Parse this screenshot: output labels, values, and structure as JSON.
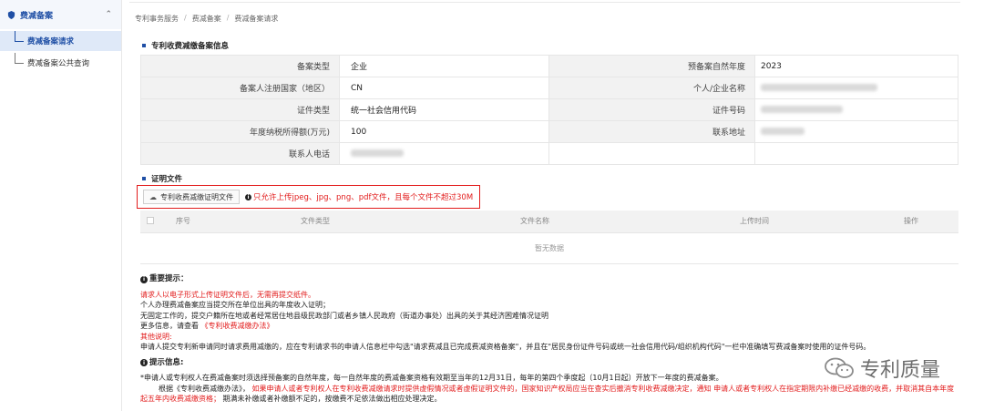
{
  "sidebar": {
    "group_label": "费减备案",
    "items": [
      {
        "label": "费减备案请求",
        "active": true
      },
      {
        "label": "费减备案公共查询",
        "active": false
      }
    ]
  },
  "breadcrumb": [
    "专利事务服务",
    "费减备案",
    "费减备案请求"
  ],
  "info": {
    "section_title": "专利收费减缴备案信息",
    "rows": [
      {
        "l1": "备案类型",
        "v1": "企业",
        "l2": "预备案自然年度",
        "v2": "2023"
      },
      {
        "l1": "备案人注册国家（地区）",
        "v1": "CN",
        "l2": "个人/企业名称",
        "v2": ""
      },
      {
        "l1": "证件类型",
        "v1": "统一社会信用代码",
        "l2": "证件号码",
        "v2": ""
      },
      {
        "l1": "年度纳税所得额(万元)",
        "v1": "100",
        "l2": "联系地址",
        "v2": ""
      },
      {
        "l1": "联系人电话",
        "v1": "",
        "l2": "",
        "v2": ""
      }
    ]
  },
  "files": {
    "section_title": "证明文件",
    "upload_button": "专利收费减缴证明文件",
    "upload_tip": "只允许上传jpeg、jpg、png、pdf文件，且每个文件不超过30M",
    "columns": [
      "序号",
      "文件类型",
      "文件名称",
      "上传时间",
      "操作"
    ],
    "empty_text": "暂无数据"
  },
  "notes": {
    "important_title": "重要提示：",
    "red_line": "请求人以电子形式上传证明文件后，无需再提交纸件。",
    "line1": "个人办理费减备案应当提交所在单位出具的年度收入证明；",
    "line2": "无固定工作的，提交户籍所在地或者经常居住地县级民政部门或者乡镇人民政府（街道办事处）出具的关于其经济困难情况证明",
    "line3_prefix": "更多信息，请查看",
    "line3_link": "《专利收费减缴办法》",
    "other_label": "其他说明:",
    "line4": "申请人提交专利新申请同时请求费用减缴的，应在专利请求书的申请人信息栏中勾选\"请求费减且已完成费减资格备案\"，并且在\"居民身份证件号码或统一社会信用代码/组织机构代码\"一栏中准确填写费减备案时使用的证件号码。",
    "tips_title": "提示信息:",
    "tip1": "*申请人或专利权人在费减备案时须选择预备案的自然年度，每一自然年度的费减备案资格有效期至当年的12月31日，每年的第四个季度起（10月1日起）开放下一年度的费减备案。",
    "tip2_prefix": "根据《专利收费减缴办法》，",
    "tip2_red": "如果申请人或者专利权人在专利收费减缴请求时提供虚假情况或者虚假证明文件的，国家知识产权局应当在查实后撤消专利收费减缴决定，通知 申请人或者专利权人在指定期限内补缴已经减缴的收费，并取消其自本年度起五年内收费减缴资格；",
    "tip2_suffix": "期满未补缴或者补缴额不足的，按缴费不足依法做出相应处理决定。"
  },
  "watermark": {
    "text": "专利质量"
  },
  "colors": {
    "accent": "#1f4fa5",
    "warning_red": "#e21c1c",
    "label_bg": "#f2f2f2"
  }
}
